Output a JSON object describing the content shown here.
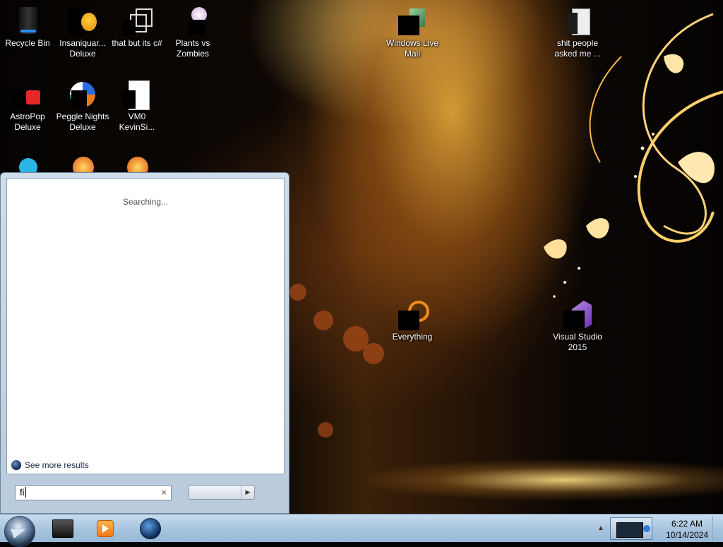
{
  "desktop_icons": [
    {
      "label": "Recycle Bin",
      "icon": "recycle-bin-icon"
    },
    {
      "label": "Insaniquar... Deluxe",
      "icon": "fish-game-icon"
    },
    {
      "label": "that but its c#",
      "icon": "shortcut-icon"
    },
    {
      "label": "Plants vs Zombies",
      "icon": "plants-vs-zombies-icon"
    },
    {
      "label": "AstroPop Deluxe",
      "icon": "astropop-icon"
    },
    {
      "label": "Peggle Nights Deluxe",
      "icon": "peggle-icon"
    },
    {
      "label": "VM0 KevinSi...",
      "icon": "document-icon"
    },
    {
      "label": "Windows Live Mail",
      "icon": "mail-icon"
    },
    {
      "label": "shit people asked me ...",
      "icon": "text-file-icon"
    },
    {
      "label": "Everything",
      "icon": "everything-search-icon"
    },
    {
      "label": "Visual Studio 2015",
      "icon": "visual-studio-icon"
    }
  ],
  "start_menu": {
    "status_text": "Searching...",
    "see_more_label": "See more results",
    "search_value": "fi",
    "clear_glyph": "×",
    "shutdown_arrow": "▶"
  },
  "taskbar": {
    "pinned": [
      {
        "icon": "terminal-icon"
      },
      {
        "icon": "media-player-icon"
      },
      {
        "icon": "globe-icon"
      }
    ],
    "tray_up_glyph": "▲",
    "clock_time": "6:22 AM",
    "clock_date": "10/14/2024"
  },
  "colors": {
    "taskbar": "#a9c5df",
    "accent_gold": "#f0af3c"
  }
}
